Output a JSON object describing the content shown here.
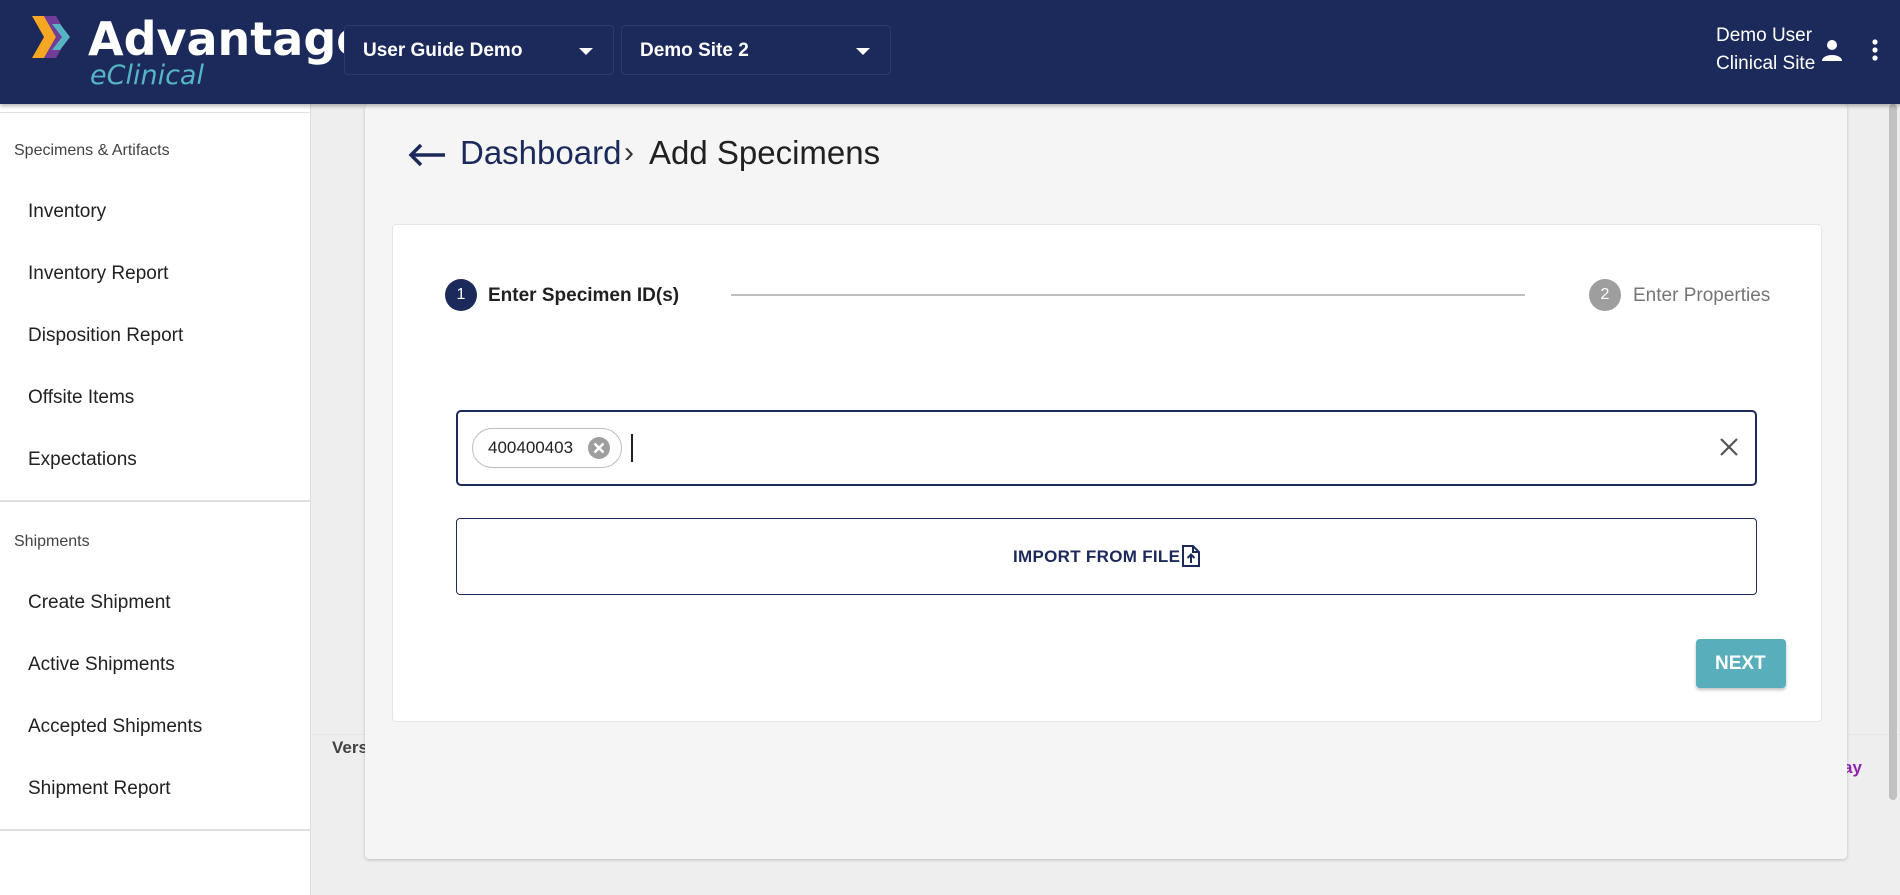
{
  "brand": {
    "title": "Advantage",
    "subtitle": "eClinical",
    "colors": {
      "navy": "#1b2a5a",
      "teal": "#56b4c3",
      "orange": "#f5a623",
      "purple": "#7b3fa0"
    }
  },
  "header": {
    "study_select": {
      "value": "User Guide Demo"
    },
    "site_select": {
      "value": "Demo Site 2"
    },
    "user": {
      "name": "Demo User",
      "role": "Clinical Site"
    }
  },
  "sidebar": {
    "sections": [
      {
        "title": "Specimens & Artifacts",
        "items": [
          "Inventory",
          "Inventory Report",
          "Disposition Report",
          "Offsite Items",
          "Expectations"
        ]
      },
      {
        "title": "Shipments",
        "items": [
          "Create Shipment",
          "Active Shipments",
          "Accepted Shipments",
          "Shipment Report"
        ]
      }
    ]
  },
  "breadcrumb": {
    "link": "Dashboard",
    "separator": "›",
    "current": "Add Specimens"
  },
  "stepper": {
    "steps": [
      {
        "number": "1",
        "label": "Enter Specimen ID(s)",
        "state": "active"
      },
      {
        "number": "2",
        "label": "Enter Properties",
        "state": "inactive"
      }
    ]
  },
  "specimen_input": {
    "chips": [
      "400400403"
    ],
    "value": ""
  },
  "import_button": {
    "label": "IMPORT FROM FILE"
  },
  "next_button": {
    "label": "NEXT"
  },
  "footer": {
    "left_text": "Vers",
    "right_text": "ay"
  }
}
